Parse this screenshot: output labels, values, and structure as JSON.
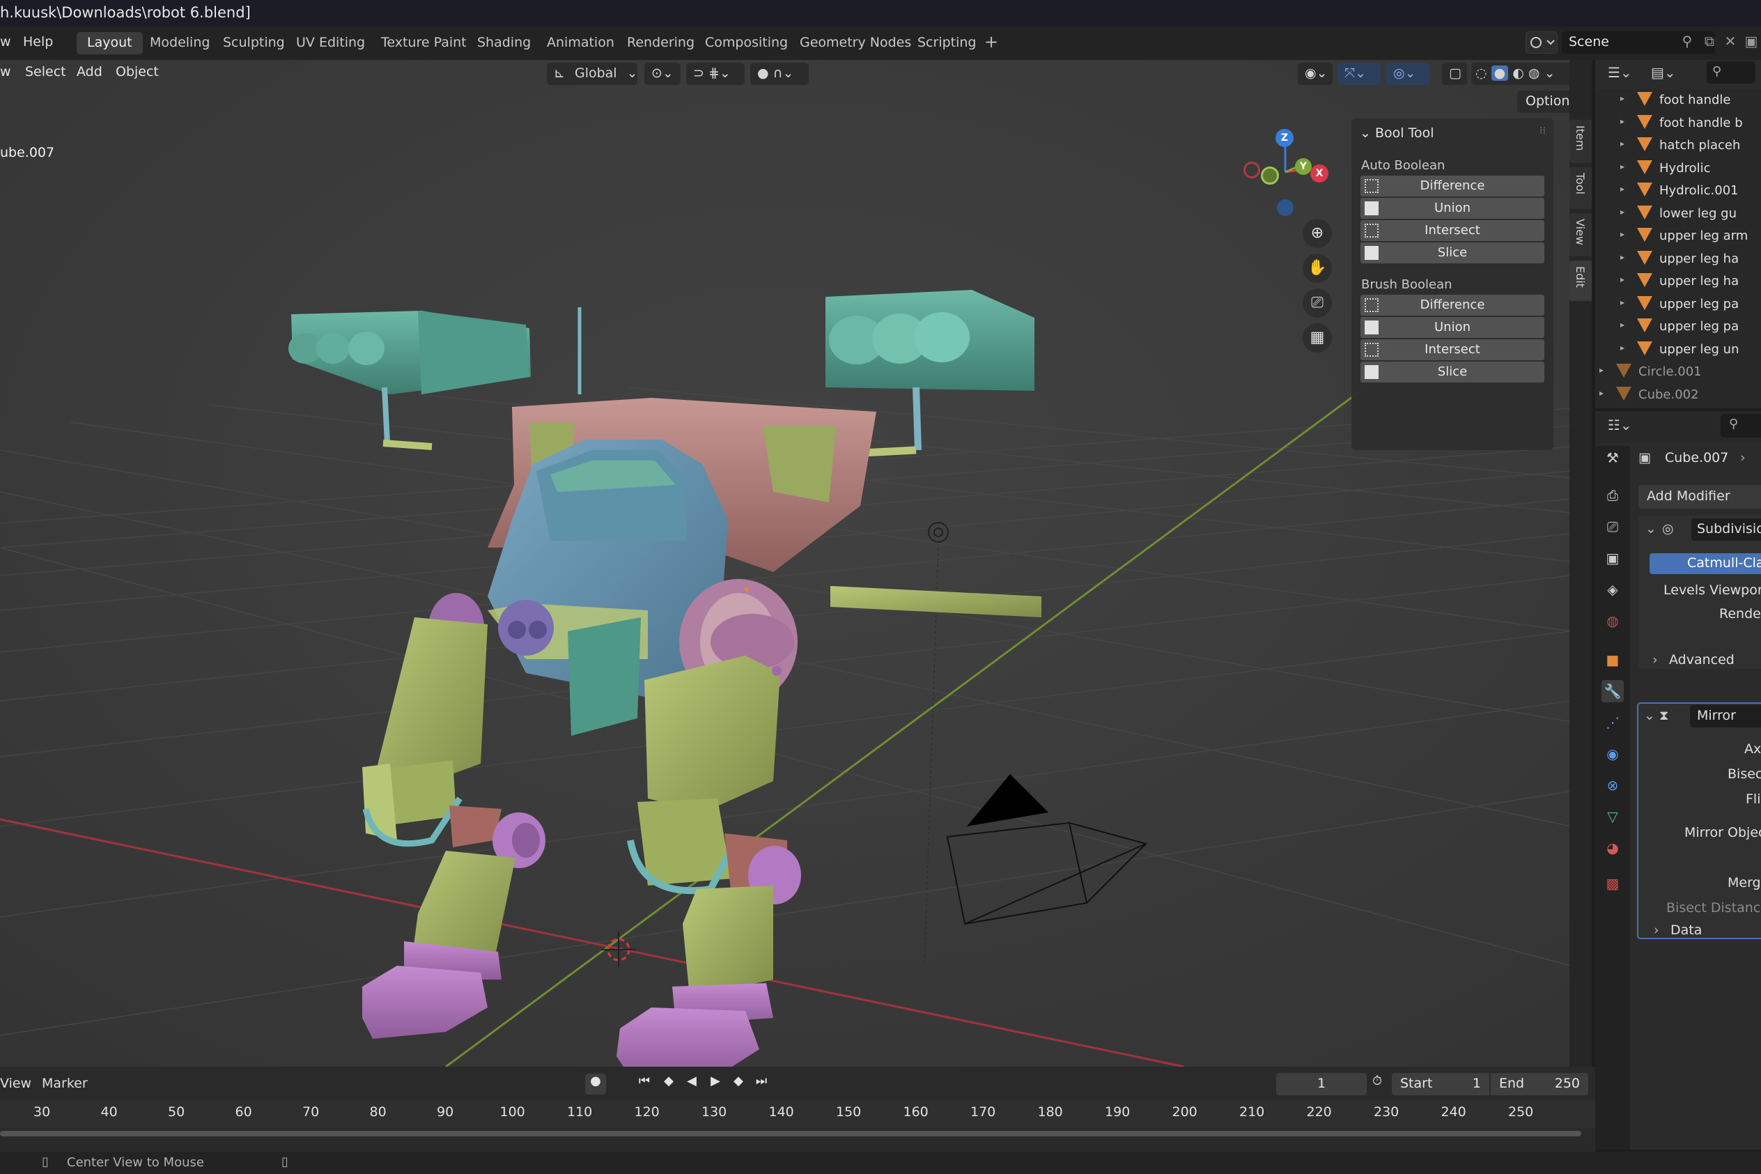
{
  "window_title": "h.kuusk\\Downloads\\robot 6.blend]",
  "menu": {
    "window": "w",
    "help": "Help"
  },
  "workspaces": [
    "Layout",
    "Modeling",
    "Sculpting",
    "UV Editing",
    "Texture Paint",
    "Shading",
    "Animation",
    "Rendering",
    "Compositing",
    "Geometry Nodes",
    "Scripting"
  ],
  "active_workspace": "Layout",
  "add_workspace": "+",
  "scene": {
    "name": "Scene"
  },
  "viewport": {
    "menu": {
      "view": "w",
      "select": "Select",
      "add": "Add",
      "object": "Object"
    },
    "orientation": "Global",
    "options": "Options",
    "object_name": "ube.007",
    "gizmo": {
      "z": "Z",
      "y": "Y",
      "x": "X"
    }
  },
  "bool_tool": {
    "title": "Bool Tool",
    "auto_section": "Auto Boolean",
    "auto_buttons": [
      "Difference",
      "Union",
      "Intersect",
      "Slice"
    ],
    "brush_section": "Brush Boolean",
    "brush_buttons": [
      "Difference",
      "Union",
      "Intersect",
      "Slice"
    ]
  },
  "sidebar_tabs": [
    "Item",
    "Tool",
    "View",
    "Edit"
  ],
  "outliner": {
    "items": [
      {
        "name": "foot handle",
        "dim": false
      },
      {
        "name": "foot handle b",
        "dim": false
      },
      {
        "name": "hatch placeh",
        "dim": false
      },
      {
        "name": "Hydrolic",
        "dim": false
      },
      {
        "name": "Hydrolic.001",
        "dim": false
      },
      {
        "name": "lower leg gu",
        "dim": false
      },
      {
        "name": "upper leg arm",
        "dim": false
      },
      {
        "name": "upper leg ha",
        "dim": false
      },
      {
        "name": "upper leg ha",
        "dim": false
      },
      {
        "name": "upper leg pa",
        "dim": false
      },
      {
        "name": "upper leg pa",
        "dim": false
      },
      {
        "name": "upper leg un",
        "dim": false
      },
      {
        "name": "Circle.001",
        "dim": true
      },
      {
        "name": "Cube.002",
        "dim": true
      }
    ]
  },
  "properties": {
    "object": "Cube.007",
    "add_modifier": "Add Modifier",
    "modifiers": {
      "subdivision": {
        "name": "Subdivision",
        "method": "Catmull-Clark",
        "levels_viewport": "Levels Viewport",
        "render": "Render",
        "advanced": "Advanced"
      },
      "mirror": {
        "name": "Mirror",
        "axis": "Axis",
        "bisect": "Bisect",
        "flip": "Flip",
        "mirror_object": "Mirror Object",
        "merge": "Merge",
        "bisect_distance": "Bisect Distance",
        "data": "Data"
      }
    }
  },
  "timeline": {
    "menu": {
      "view": "View",
      "marker": "Marker"
    },
    "current_frame": "1",
    "start_label": "Start",
    "start": "1",
    "end_label": "End",
    "end": "250",
    "ruler": [
      "30",
      "40",
      "50",
      "60",
      "70",
      "80",
      "90",
      "100",
      "110",
      "120",
      "130",
      "140",
      "150",
      "160",
      "170",
      "180",
      "190",
      "200",
      "210",
      "220",
      "230",
      "240",
      "250"
    ]
  },
  "status": {
    "hint": "Center View to Mouse"
  },
  "colors": {
    "accent_blue": "#4772b3",
    "outliner_mesh": "#e08a3a",
    "axis_x": "#d83a4a",
    "axis_y": "#7ea73a",
    "axis_z": "#3a7dd8"
  }
}
